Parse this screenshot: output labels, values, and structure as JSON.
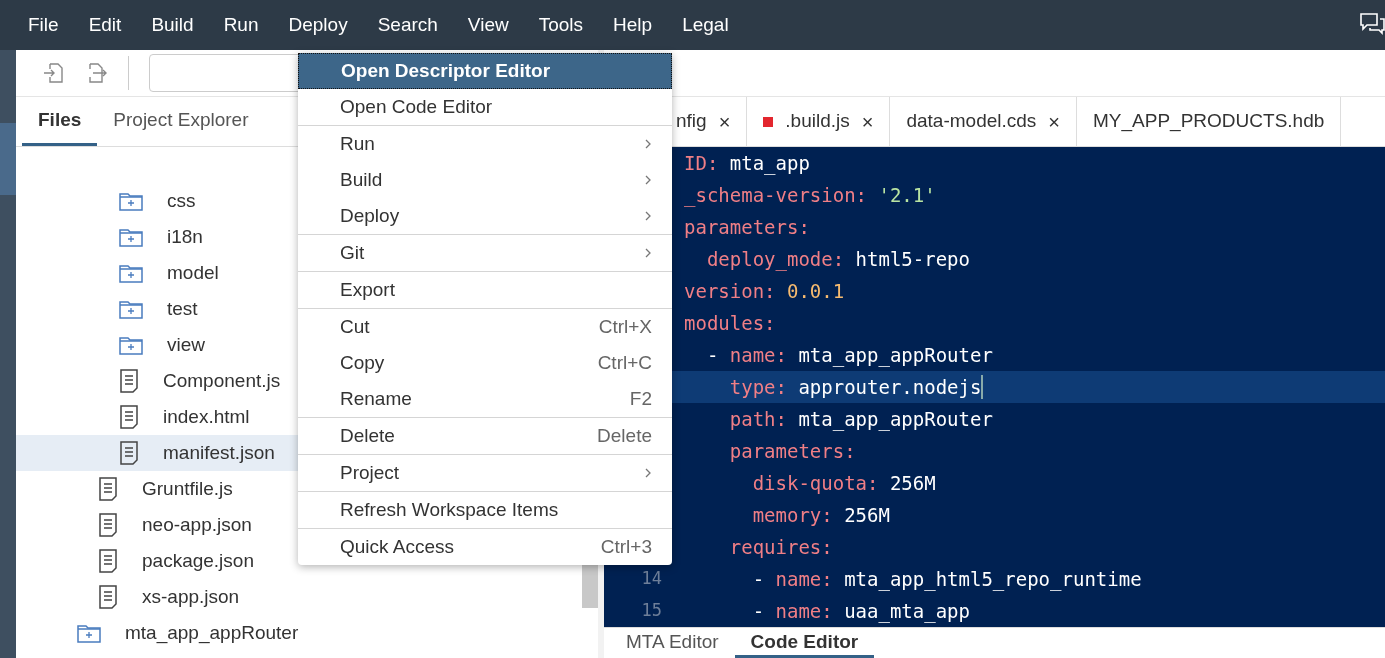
{
  "menu_bar": [
    "File",
    "Edit",
    "Build",
    "Run",
    "Deploy",
    "Search",
    "View",
    "Tools",
    "Help",
    "Legal"
  ],
  "side_tabs": [
    {
      "label": "Files",
      "selected": true
    },
    {
      "label": "Project Explorer",
      "selected": false
    }
  ],
  "tree": [
    {
      "children": [
        {
          "children": [
            {
              "label": "css",
              "kind": "folder",
              "selected": false
            },
            {
              "label": "i18n",
              "kind": "folder",
              "selected": false
            },
            {
              "label": "model",
              "kind": "folder",
              "selected": false
            },
            {
              "label": "test",
              "kind": "folder",
              "selected": false
            },
            {
              "label": "view",
              "kind": "folder",
              "selected": false
            },
            {
              "label": "Component.js",
              "kind": "file",
              "selected": false
            },
            {
              "label": "index.html",
              "kind": "file",
              "selected": false
            },
            {
              "label": "manifest.json",
              "kind": "file",
              "selected": true
            }
          ]
        },
        {
          "label": "Gruntfile.js",
          "kind": "file",
          "selected": false
        },
        {
          "label": "neo-app.json",
          "kind": "file",
          "selected": false
        },
        {
          "label": "package.json",
          "kind": "file",
          "selected": false
        },
        {
          "label": "xs-app.json",
          "kind": "file",
          "selected": false
        }
      ]
    },
    {
      "label": "mta_app_appRouter",
      "kind": "folder",
      "selected": false
    }
  ],
  "editor_tabs": [
    {
      "label": "nfig",
      "modified": false,
      "close": "×"
    },
    {
      "label": ".build.js",
      "modified": true,
      "close": "×"
    },
    {
      "label": "data-model.cds",
      "modified": false,
      "close": "×"
    },
    {
      "label": "MY_APP_PRODUCTS.hdb",
      "modified": false
    }
  ],
  "code_lines": [
    {
      "parts": [
        {
          "kind": "key",
          "text": "ID:"
        },
        {
          "kind": "plain",
          "text": " mta_app"
        }
      ]
    },
    {
      "parts": [
        {
          "kind": "key",
          "text": "_schema-version:"
        },
        {
          "kind": "string",
          "text": " '2.1'"
        }
      ]
    },
    {
      "parts": [
        {
          "kind": "key",
          "text": "parameters:"
        }
      ]
    },
    {
      "parts": [
        {
          "kind": "key",
          "text": "  deploy_mode:"
        },
        {
          "kind": "plain",
          "text": " html5-repo"
        }
      ]
    },
    {
      "parts": [
        {
          "kind": "key",
          "text": "version:"
        },
        {
          "kind": "number",
          "text": " 0.0.1"
        }
      ]
    },
    {
      "parts": [
        {
          "kind": "key",
          "text": "modules:"
        }
      ]
    },
    {
      "parts": [
        {
          "kind": "plain",
          "text": "  - "
        },
        {
          "kind": "key",
          "text": "name:"
        },
        {
          "kind": "plain",
          "text": " mta_app_appRouter"
        }
      ]
    },
    {
      "highlighted": true,
      "parts": [
        {
          "kind": "key",
          "text": "    type:"
        },
        {
          "kind": "plain",
          "text": " approuter.nodejs"
        }
      ]
    },
    {
      "parts": [
        {
          "kind": "key",
          "text": "    path:"
        },
        {
          "kind": "plain",
          "text": " mta_app_appRouter"
        }
      ]
    },
    {
      "parts": [
        {
          "kind": "key",
          "text": "    parameters:"
        }
      ]
    },
    {
      "parts": [
        {
          "kind": "key",
          "text": "      disk-quota:"
        },
        {
          "kind": "plain",
          "text": " 256M"
        }
      ]
    },
    {
      "parts": [
        {
          "kind": "key",
          "text": "      memory:"
        },
        {
          "kind": "plain",
          "text": " 256M"
        }
      ]
    },
    {
      "parts": [
        {
          "kind": "key",
          "text": "    requires:"
        }
      ]
    },
    {
      "number": "14",
      "parts": [
        {
          "kind": "plain",
          "text": "      - "
        },
        {
          "kind": "key",
          "text": "name:"
        },
        {
          "kind": "plain",
          "text": " mta_app_html5_repo_runtime"
        }
      ]
    },
    {
      "number": "15",
      "parts": [
        {
          "kind": "plain",
          "text": "      - "
        },
        {
          "kind": "key",
          "text": "name:"
        },
        {
          "kind": "plain",
          "text": " uaa_mta_app"
        }
      ]
    }
  ],
  "bottom_tabs": [
    {
      "label": "MTA Editor",
      "selected": false
    },
    {
      "label": "Code Editor",
      "selected": true
    }
  ],
  "context_menu": [
    [
      {
        "label": "Open Descriptor Editor",
        "selected": true,
        "submenu": false
      },
      {
        "label": "Open Code Editor",
        "selected": false,
        "submenu": false
      }
    ],
    [
      {
        "label": "Run",
        "selected": false,
        "submenu": true
      },
      {
        "label": "Build",
        "selected": false,
        "submenu": true
      },
      {
        "label": "Deploy",
        "selected": false,
        "submenu": true
      }
    ],
    [
      {
        "label": "Git",
        "selected": false,
        "submenu": true
      }
    ],
    [
      {
        "label": "Export",
        "selected": false,
        "submenu": false
      }
    ],
    [
      {
        "label": "Cut",
        "shortcut": "Ctrl+X",
        "selected": false,
        "submenu": false
      },
      {
        "label": "Copy",
        "shortcut": "Ctrl+C",
        "selected": false,
        "submenu": false
      },
      {
        "label": "Rename",
        "shortcut": "F2",
        "selected": false,
        "submenu": false
      }
    ],
    [
      {
        "label": "Delete",
        "shortcut": "Delete",
        "selected": false,
        "submenu": false
      }
    ],
    [
      {
        "label": "Project",
        "selected": false,
        "submenu": true
      }
    ],
    [
      {
        "label": "Refresh Workspace Items",
        "selected": false,
        "submenu": false
      }
    ],
    [
      {
        "label": "Quick Access",
        "shortcut": "Ctrl+3",
        "selected": false,
        "submenu": false
      }
    ]
  ]
}
